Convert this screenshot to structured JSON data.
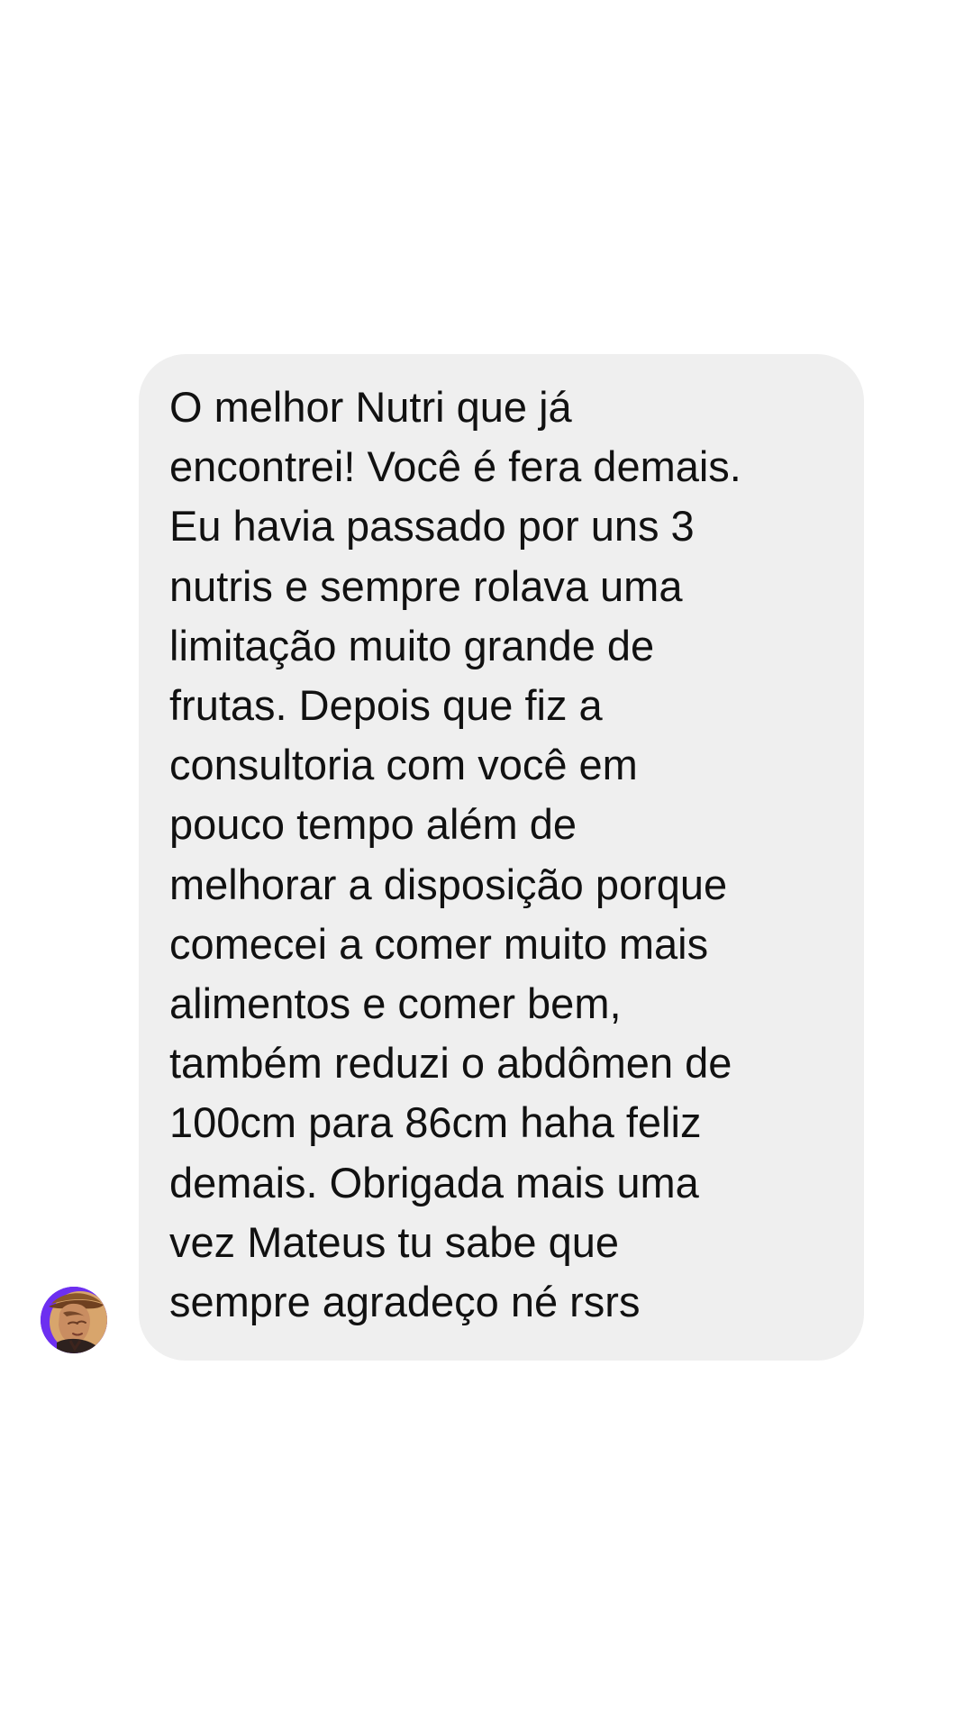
{
  "conversation": {
    "message": {
      "text": "O melhor Nutri que já\nencontrei! Você é fera demais.\nEu havia passado por uns 3\nnutris e sempre rolava uma\nlimitação muito grande de\nfrutas. Depois que fiz a\nconsultoria com você em\npouco tempo além de\nmelhorar a disposição porque\ncomecei a comer muito mais\nalimentos e comer bem,\ntambém reduzi o abdômen de\n100cm para 86cm haha feliz\ndemais. Obrigada mais uma\nvez Mateus tu sabe que\nsempre agradeço né rsrs",
      "bubble_color": "#efefef",
      "text_color": "#111111"
    },
    "sender": {
      "avatar_icon": "profile-photo-avatar",
      "avatar_accent_color": "#6d2ff0"
    }
  }
}
